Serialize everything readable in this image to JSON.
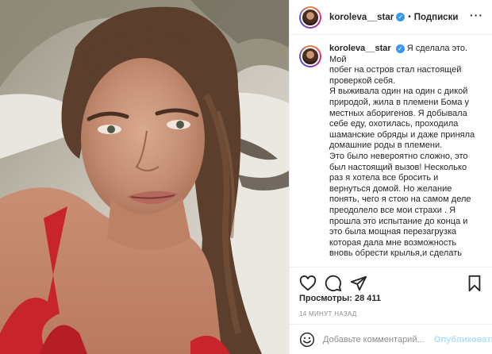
{
  "post": {
    "username": "koroleva__star",
    "verified_icon": "verified-badge-icon",
    "separator": "•",
    "follow_label": "Подписки",
    "more_label": "···",
    "caption_lines": [
      "Я сделала это. Мой",
      "побег на остров стал настоящей",
      "проверкой себя.",
      "Я выживала один на один с дикой",
      "природой, жила в племени Бома у",
      "местных аборигенов. Я добывала",
      "себе еду, охотилась, проходила",
      "шаманские обряды и даже приняла",
      "домашние роды в племени.",
      "Это было невероятно сложно, это",
      "был настоящий вызов! Несколько",
      "раз я хотела все бросить и",
      "вернуться домой. Но желание",
      "понять, чего я стою на самом деле",
      "преодолело все мои страхи . Я",
      "прошла это испытание до конца и",
      "это была мощная перезагрузка",
      "которая дала мне возможность",
      "вновь обрести крылья,и сделать"
    ],
    "views_label": "Просмотры: 28 411",
    "time_ago": "14 минут назад",
    "comment_placeholder": "Добавьте комментарий...",
    "post_button": "Опубликовать"
  },
  "icons": {
    "like": "heart-icon",
    "comment": "comment-icon",
    "share": "paper-plane-icon",
    "save": "bookmark-icon",
    "emoji": "smiley-icon"
  },
  "colors": {
    "verified": "#3897f0",
    "post_button_disabled": "#b2dffc",
    "muted_text": "#8e8e8e",
    "swimsuit": "#c8242b"
  }
}
